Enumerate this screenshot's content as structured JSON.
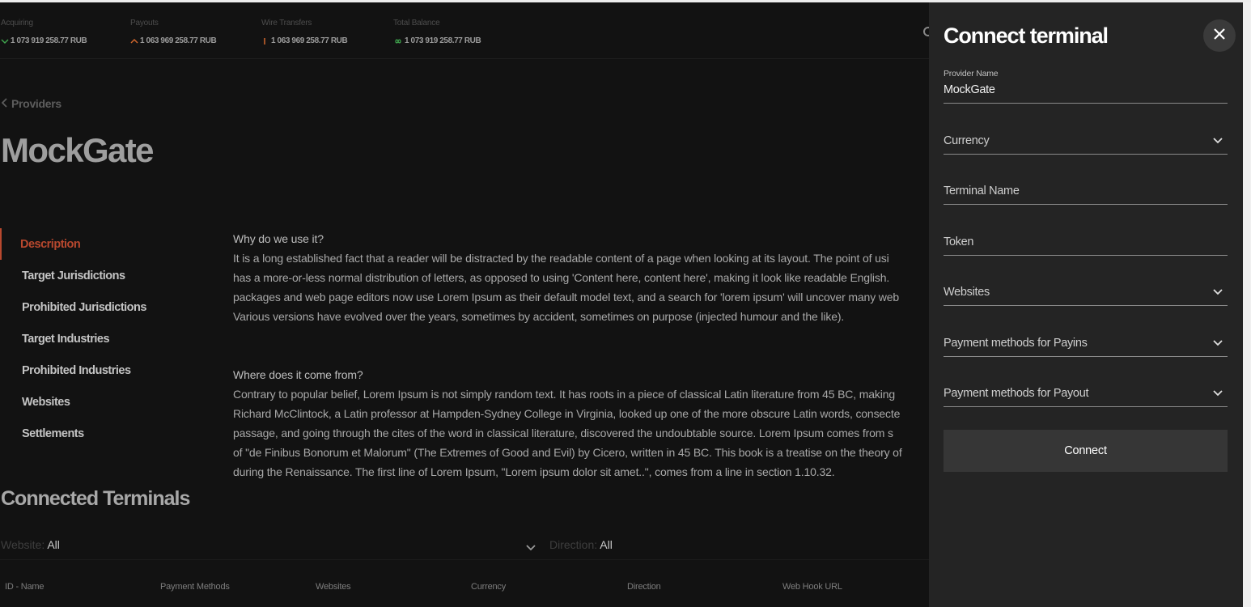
{
  "stats": [
    {
      "label": "Acquiring",
      "value": "1 073 919 258.77 RUB",
      "icon": "chevron-down-icon",
      "color": "#3fa34d"
    },
    {
      "label": "Payouts",
      "value": "1 063 969 258.77 RUB",
      "icon": "chevron-up-icon",
      "color": "#d0662c"
    },
    {
      "label": "Wire Transfers",
      "value": "1 063 969 258.77 RUB",
      "icon": "bar-icon",
      "color": "#d0662c"
    },
    {
      "label": "Total Balance",
      "value": "1 073 919 258.77 RUB",
      "icon": "infinity-icon",
      "color": "#3fa34d"
    }
  ],
  "breadcrumb": {
    "back_label": "Providers"
  },
  "page_title": "MockGate",
  "sidenav": {
    "items": [
      {
        "label": "Description",
        "active": true
      },
      {
        "label": "Target Jurisdictions"
      },
      {
        "label": "Prohibited Jurisdictions"
      },
      {
        "label": "Target Industries"
      },
      {
        "label": "Prohibited Industries"
      },
      {
        "label": "Websites"
      },
      {
        "label": "Settlements"
      }
    ]
  },
  "description": {
    "block1": {
      "heading": "Why do we use it?",
      "lines": [
        "It is a long established fact that a reader will be distracted by the readable content of a page when looking at its layout. The point of usi",
        "has a more-or-less normal distribution of letters, as opposed to using 'Content here, content here', making it look like readable English.",
        "packages and web page editors now use Lorem Ipsum as their default model text, and a search for 'lorem ipsum' will uncover many web",
        "Various versions have evolved over the years, sometimes by accident, sometimes on purpose (injected humour and the like)."
      ]
    },
    "block2": {
      "heading": "Where does it come from?",
      "lines": [
        "Contrary to popular belief, Lorem Ipsum is not simply random text. It has roots in a piece of classical Latin literature from 45 BC, making",
        "Richard McClintock, a Latin professor at Hampden-Sydney College in Virginia, looked up one of the more obscure Latin words, consecte",
        "passage, and going through the cites of the word in classical literature, discovered the undoubtable source. Lorem Ipsum comes from s",
        "of \"de Finibus Bonorum et Malorum\" (The Extremes of Good and Evil) by Cicero, written in 45 BC. This book is a treatise on the theory of",
        "during the Renaissance. The first line of Lorem Ipsum, \"Lorem ipsum dolor sit amet..\", comes from a line in section 1.10.32."
      ]
    }
  },
  "connected_terminals": {
    "title": "Connected Terminals",
    "filters": {
      "website_label": "Website:",
      "website_value": "All",
      "direction_label": "Direction:",
      "direction_value": "All"
    },
    "columns": [
      "ID - Name",
      "Payment Methods",
      "Websites",
      "Currency",
      "Direction",
      "Web Hook URL"
    ]
  },
  "drawer": {
    "title": "Connect terminal",
    "provider_label": "Provider Name",
    "provider_value": "MockGate",
    "currency_placeholder": "Currency",
    "terminal_name_placeholder": "Terminal Name",
    "token_placeholder": "Token",
    "websites_placeholder": "Websites",
    "payins_placeholder": "Payment methods for Payins",
    "payout_placeholder": "Payment methods for Payout",
    "connect_label": "Connect"
  },
  "colors": {
    "accent": "#b8482e",
    "positive": "#3fa34d",
    "warning": "#d0662c",
    "background": "#121212",
    "drawer_bg": "#242424",
    "button_bg": "#363636"
  }
}
